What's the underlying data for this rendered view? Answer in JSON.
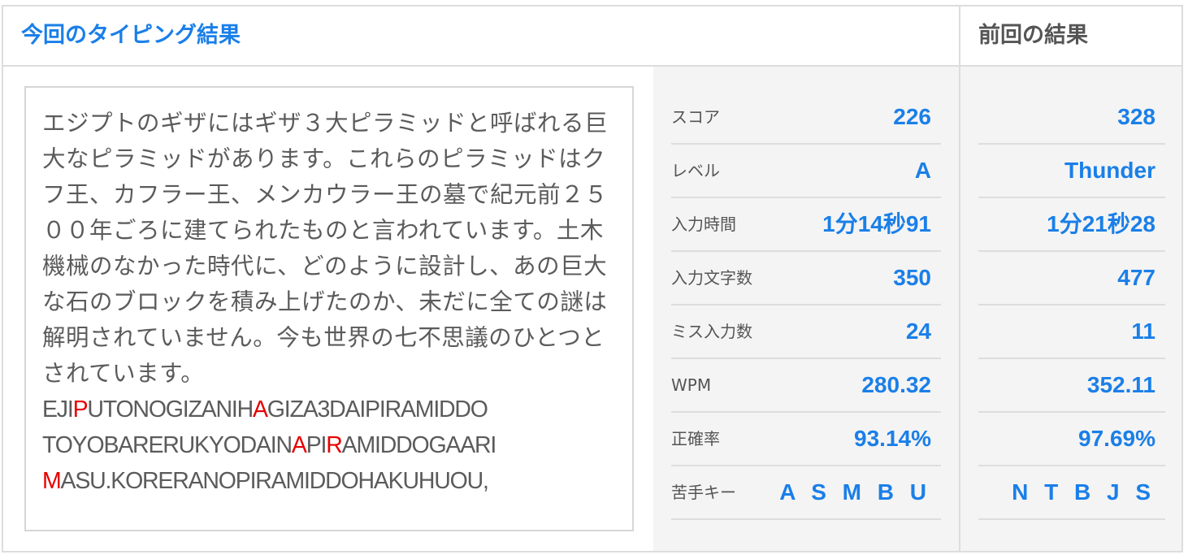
{
  "header": {
    "current_title": "今回のタイピング結果",
    "previous_title": "前回の結果"
  },
  "passage": {
    "japanese": "エジプトのギザにはギザ３大ピラミッドと呼ばれる巨大なピラミッドがあります。これらのピラミッドはクフ王、カフラー王、メンカウラー王の墓で紀元前２５００年ごろに建てられたものと言われています。土木機械のなかった時代に、どのように設計し、あの巨大な石のブロックを積み上げたのか、未だに全ての謎は解明されていません。今も世界の七不思議のひとつとされています。",
    "romaji_lines": [
      [
        {
          "t": "EJI",
          "miss": false
        },
        {
          "t": "P",
          "miss": true
        },
        {
          "t": "UTONOGIZANIH",
          "miss": false
        },
        {
          "t": "A",
          "miss": true
        },
        {
          "t": "GIZA3DAIPIRAMIDDO",
          "miss": false
        }
      ],
      [
        {
          "t": "TOYOBARERUKYODAIN",
          "miss": false
        },
        {
          "t": "A",
          "miss": true
        },
        {
          "t": "PI",
          "miss": false
        },
        {
          "t": "R",
          "miss": true
        },
        {
          "t": "AMIDDOGAARI",
          "miss": false
        }
      ],
      [
        {
          "t": "M",
          "miss": true
        },
        {
          "t": "ASU.KORERANOPIRAMIDDOHAKUHUOU,",
          "miss": false
        }
      ]
    ]
  },
  "results": {
    "labels": {
      "score": "スコア",
      "level": "レベル",
      "time": "入力時間",
      "chars": "入力文字数",
      "misses": "ミス入力数",
      "wpm": "WPM",
      "accuracy": "正確率",
      "weak_keys": "苦手キー"
    },
    "current": {
      "score": "226",
      "level": "A",
      "time": "1分14秒91",
      "chars": "350",
      "misses": "24",
      "wpm": "280.32",
      "accuracy": "93.14%",
      "weak_keys": "A S M B U"
    },
    "previous": {
      "score": "328",
      "level": "Thunder",
      "time": "1分21秒28",
      "chars": "477",
      "misses": "11",
      "wpm": "352.11",
      "accuracy": "97.69%",
      "weak_keys": "N T B J S"
    }
  },
  "colors": {
    "accent": "#1a7fe8",
    "miss": "#e60000",
    "text": "#555555",
    "panel_bg": "#f4f4f4",
    "border": "#dddddd"
  }
}
